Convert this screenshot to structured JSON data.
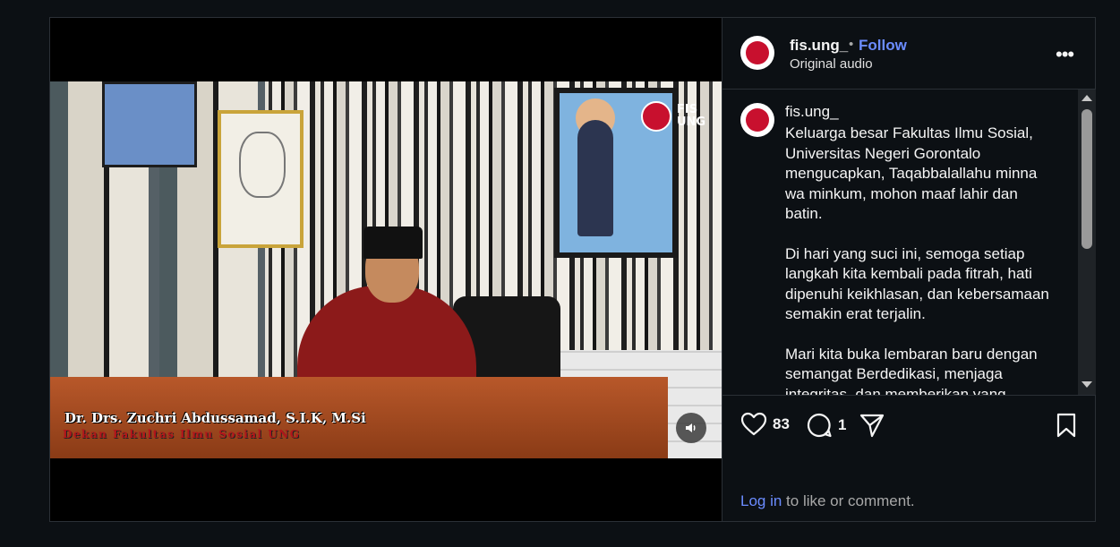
{
  "post": {
    "video": {
      "name_caption": "Dr. Drs. Zuchri Abdussamad, S.I.K, M.Si",
      "title_caption": "Dekan Fakultas Ilmu Sosial UNG",
      "watermark_line1": "FIS",
      "watermark_line2": "UNG"
    },
    "header": {
      "username": "fis.ung_",
      "separator": "•",
      "follow_label": "Follow",
      "audio_label": "Original audio"
    },
    "caption": {
      "username": "fis.ung_",
      "paragraphs": [
        "Keluarga besar Fakultas Ilmu Sosial, Universitas Negeri Gorontalo mengucapkan, Taqabbalallahu minna wa minkum, mohon maaf lahir dan batin.",
        "Di hari yang suci ini, semoga setiap langkah kita kembali pada fitrah, hati dipenuhi keikhlasan, dan kebersamaan semakin erat terjalin.",
        "Mari kita buka lembaran baru dengan semangat  Berdedikasi, menjaga integritas, dan memberikan yang"
      ]
    },
    "actions": {
      "likes": "83",
      "comments": "1"
    },
    "login": {
      "link": "Log in",
      "text": " to like or comment."
    },
    "icons": [
      "heart-icon",
      "comment-icon",
      "share-icon",
      "bookmark-icon",
      "more-icon",
      "volume-icon"
    ]
  }
}
